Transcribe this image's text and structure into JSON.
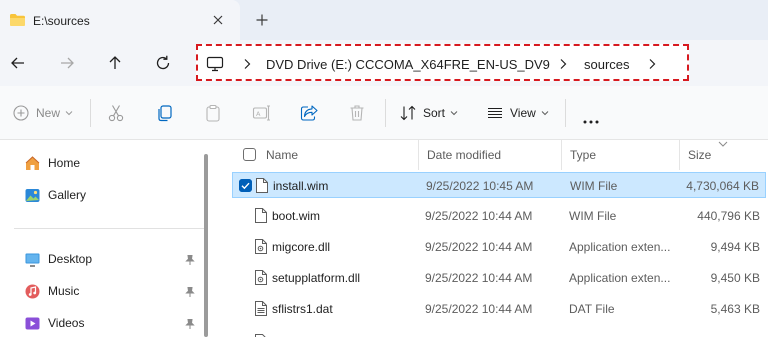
{
  "tab": {
    "title": "E:\\sources",
    "close_icon": "close-icon",
    "new_tab_icon": "plus-icon"
  },
  "nav": {
    "address": {
      "drive": "DVD Drive (E:) CCCOMA_X64FRE_EN-US_DV9",
      "folder": "sources"
    },
    "highlight_color": "#d7191f"
  },
  "commands": {
    "new_label": "New",
    "sort_label": "Sort",
    "view_label": "View"
  },
  "sidebar": {
    "items": [
      {
        "label": "Home",
        "icon": "home-icon",
        "pinned": false
      },
      {
        "label": "Gallery",
        "icon": "gallery-icon",
        "pinned": false
      },
      {
        "label": "Desktop",
        "icon": "desktop-icon",
        "pinned": true
      },
      {
        "label": "Music",
        "icon": "music-icon",
        "pinned": true
      },
      {
        "label": "Videos",
        "icon": "videos-icon",
        "pinned": true
      }
    ]
  },
  "columns": {
    "name": "Name",
    "date": "Date modified",
    "type": "Type",
    "size": "Size"
  },
  "files": [
    {
      "name": "install.wim",
      "date": "9/25/2022 10:45 AM",
      "type": "WIM File",
      "size": "4,730,064 KB",
      "selected": true,
      "icon": "file-icon"
    },
    {
      "name": "boot.wim",
      "date": "9/25/2022 10:44 AM",
      "type": "WIM File",
      "size": "440,796 KB",
      "selected": false,
      "icon": "file-icon"
    },
    {
      "name": "migcore.dll",
      "date": "9/25/2022 10:44 AM",
      "type": "Application exten...",
      "size": "9,494 KB",
      "selected": false,
      "icon": "dll-file-icon"
    },
    {
      "name": "setupplatform.dll",
      "date": "9/25/2022 10:44 AM",
      "type": "Application exten...",
      "size": "9,450 KB",
      "selected": false,
      "icon": "dll-file-icon"
    },
    {
      "name": "sflistrs1.dat",
      "date": "9/25/2022 10:44 AM",
      "type": "DAT File",
      "size": "5,463 KB",
      "selected": false,
      "icon": "dat-file-icon"
    }
  ],
  "colors": {
    "selection_bg": "#cce8ff",
    "selection_border": "#99d1ff",
    "accent": "#005fb8"
  }
}
